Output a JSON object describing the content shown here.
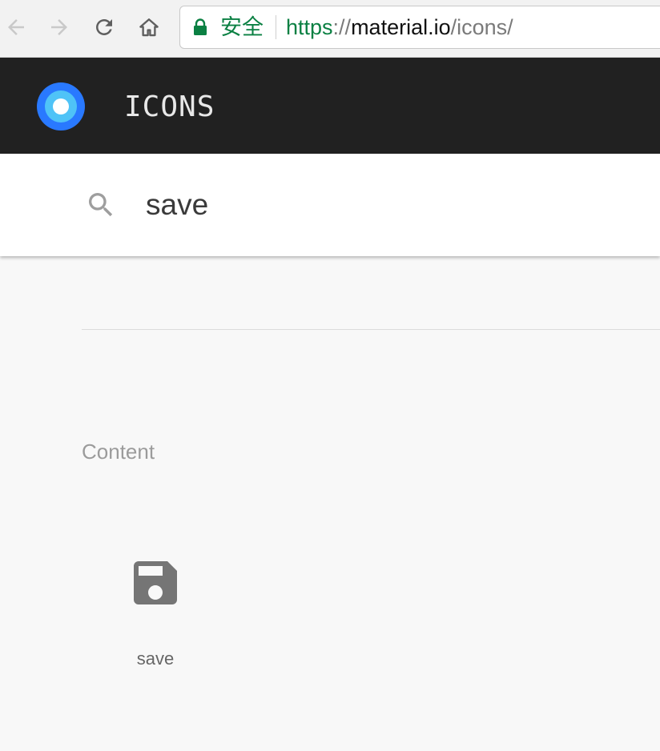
{
  "browser": {
    "back_icon": "arrow-left-icon",
    "forward_icon": "arrow-right-icon",
    "reload_icon": "reload-icon",
    "home_icon": "home-icon",
    "secure_label": "安全",
    "url": {
      "scheme": "https",
      "separator": "://",
      "host": "material.io",
      "path": "/icons/"
    },
    "colors": {
      "secure_green": "#0b8043"
    }
  },
  "header": {
    "title": "ICONS",
    "logo_icon": "material-logo-icon",
    "colors": {
      "background": "#212121",
      "logo_outer": "#2979ff",
      "logo_inner": "#4fc3f7"
    }
  },
  "search": {
    "icon": "search-icon",
    "value": "save"
  },
  "results": {
    "categories": [
      {
        "title": "Content",
        "icons": [
          {
            "name": "save",
            "icon": "save-icon"
          }
        ]
      }
    ]
  }
}
